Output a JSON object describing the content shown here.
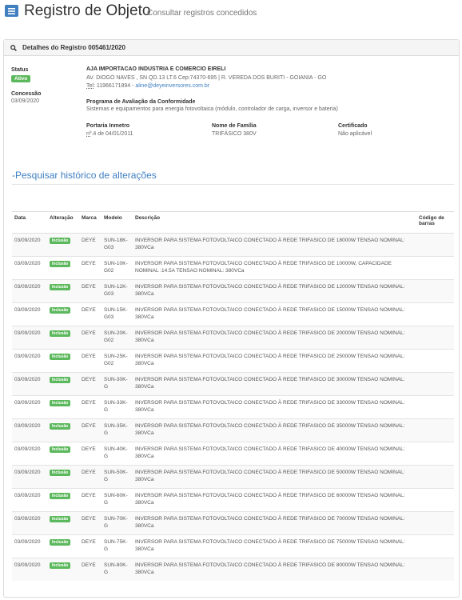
{
  "header": {
    "title": "Registro de Objeto",
    "subtitle": "Consultar registros concedidos"
  },
  "panel": {
    "title": "Detalhes do Registro 005461/2020"
  },
  "details": {
    "status_label": "Status",
    "status_value": "Ativo",
    "concessao_label": "Concessão",
    "concessao_value": "03/09/2020",
    "company_name": "AJA IMPORTACAO INDUSTRIA E COMERCIO EIRELI",
    "address": "AV. DIOGO NAVES , SN QD.13 LT.6 Cep:74370-695 | R. VEREDA DOS BURITI - GOIANIA - GO",
    "tel_label": "Tel:",
    "phone": "11966171894",
    "separator": " - ",
    "email": "aline@deyeinversores.com.br",
    "program_label": "Programa de Avaliação da Conformidade",
    "program_value": "Sistemas e equipamentos para energia fotovoltaica (módulo, controlador de carga, inversor e bateria)",
    "portaria_label": "Portaria Inmetro",
    "portaria_no": "nº",
    "portaria_value": ".4 de 04/01/2011",
    "familia_label": "Nome de Família",
    "familia_value": "TRIFÁSICO 380V",
    "certificado_label": "Certificado",
    "certificado_value": "Não aplicável"
  },
  "history": {
    "title": "-Pesquisar histórico de alterações",
    "columns": [
      "Data",
      "Alteração",
      "Marca",
      "Modelo",
      "Descrição",
      "Código de barras"
    ],
    "rows": [
      {
        "data": "03/09/2020",
        "alteracao": "Inclusão",
        "marca": "DEYE",
        "modelo": "SUN-18K-G03",
        "descricao": "INVERSOR PARA SISTEMA FOTOVOLTAICO CONECTADO À REDE TRIFASICO DE 18000W TENSAO NOMINAL: 380VCa",
        "codigo": ""
      },
      {
        "data": "03/09/2020",
        "alteracao": "Inclusão",
        "marca": "DEYE",
        "modelo": "SUN-10K-G02",
        "descricao": "INVERSOR PARA SISTEMA FOTOVOLTAICO CONECTADO À REDE TRIFASICO DE 10000W, CAPACIDADE NOMINAL :14.5A TENSAO NOMINAL: 380VCa",
        "codigo": ""
      },
      {
        "data": "03/09/2020",
        "alteracao": "Inclusão",
        "marca": "DEYE",
        "modelo": "SUN-12K-G03",
        "descricao": "INVERSOR PARA SISTEMA FOTOVOLTAICO CONECTADO À REDE TRIFASICO DE 12000W TENSAO NOMINAL: 380VCa",
        "codigo": ""
      },
      {
        "data": "03/09/2020",
        "alteracao": "Inclusão",
        "marca": "DEYE",
        "modelo": "SUN-15K-G03",
        "descricao": "INVERSOR PARA SISTEMA FOTOVOLTAICO CONECTADO À REDE TRIFASICO DE 15000W TENSAO NOMINAL: 380VCa",
        "codigo": ""
      },
      {
        "data": "03/09/2020",
        "alteracao": "Inclusão",
        "marca": "DEYE",
        "modelo": "SUN-20K-G02",
        "descricao": "INVERSOR PARA SISTEMA FOTOVOLTAICO CONECTADO À REDE TRIFASICO DE 20000W TENSAO NOMINAL: 380VCa",
        "codigo": ""
      },
      {
        "data": "03/09/2020",
        "alteracao": "Inclusão",
        "marca": "DEYE",
        "modelo": "SUN-25K-G02",
        "descricao": "INVERSOR PARA SISTEMA FOTOVOLTAICO CONECTADO À REDE TRIFASICO DE 25000W TENSAO NOMINAL: 380VCa",
        "codigo": ""
      },
      {
        "data": "03/09/2020",
        "alteracao": "Inclusão",
        "marca": "DEYE",
        "modelo": "SUN-30K-G",
        "descricao": "INVERSOR PARA SISTEMA FOTOVOLTAICO CONECTADO À REDE TRIFASICO DE 30000W TENSAO NOMINAL: 380VCa",
        "codigo": ""
      },
      {
        "data": "03/09/2020",
        "alteracao": "Inclusão",
        "marca": "DEYE",
        "modelo": "SUN-33K-G",
        "descricao": "INVERSOR PARA SISTEMA FOTOVOLTAICO CONECTADO À REDE TRIFASICO DE 33000W TENSAO NOMINAL: 380VCa",
        "codigo": ""
      },
      {
        "data": "03/09/2020",
        "alteracao": "Inclusão",
        "marca": "DEYE",
        "modelo": "SUN-35K-G",
        "descricao": "INVERSOR PARA SISTEMA FOTOVOLTAICO CONECTADO À REDE TRIFASICO DE 35000W TENSAO NOMINAL: 380VCa",
        "codigo": ""
      },
      {
        "data": "03/09/2020",
        "alteracao": "Inclusão",
        "marca": "DEYE",
        "modelo": "SUN-40K-G",
        "descricao": "INVERSOR PARA SISTEMA FOTOVOLTAICO CONECTADO À REDE TRIFASICO DE 40000W TENSAO NOMINAL: 380VCa",
        "codigo": ""
      },
      {
        "data": "03/09/2020",
        "alteracao": "Inclusão",
        "marca": "DEYE",
        "modelo": "SUN-50K-G",
        "descricao": "INVERSOR PARA SISTEMA FOTOVOLTAICO CONECTADO À REDE TRIFASICO DE 50000W TENSAO NOMINAL: 380VCa",
        "codigo": ""
      },
      {
        "data": "03/09/2020",
        "alteracao": "Inclusão",
        "marca": "DEYE",
        "modelo": "SUN-60K-G",
        "descricao": "INVERSOR PARA SISTEMA FOTOVOLTAICO CONECTADO À REDE TRIFASICO DE 60000W TENSAO NOMINAL: 380VCa",
        "codigo": ""
      },
      {
        "data": "03/09/2020",
        "alteracao": "Inclusão",
        "marca": "DEYE",
        "modelo": "SUN-70K-G",
        "descricao": "INVERSOR PARA SISTEMA FOTOVOLTAICO CONECTADO À REDE TRIFASICO DE 70000W TENSAO NOMINAL: 380VCa",
        "codigo": ""
      },
      {
        "data": "03/09/2020",
        "alteracao": "Inclusão",
        "marca": "DEYE",
        "modelo": "SUN-75K-G",
        "descricao": "INVERSOR PARA SISTEMA FOTOVOLTAICO CONECTADO À REDE TRIFASICO DE 75000W TENSAO NOMINAL: 380VCa",
        "codigo": ""
      },
      {
        "data": "03/09/2020",
        "alteracao": "Inclusão",
        "marca": "DEYE",
        "modelo": "SUN-80K-G",
        "descricao": "INVERSOR PARA SISTEMA FOTOVOLTAICO CONECTADO À REDE TRIFASICO DE 80000W TENSAO NOMINAL: 380VCa",
        "codigo": ""
      }
    ]
  },
  "colors": {
    "accent": "#3f7fc0",
    "success": "#5cb85c"
  },
  "icons": {
    "menu": "menu-icon",
    "search": "search-icon"
  }
}
